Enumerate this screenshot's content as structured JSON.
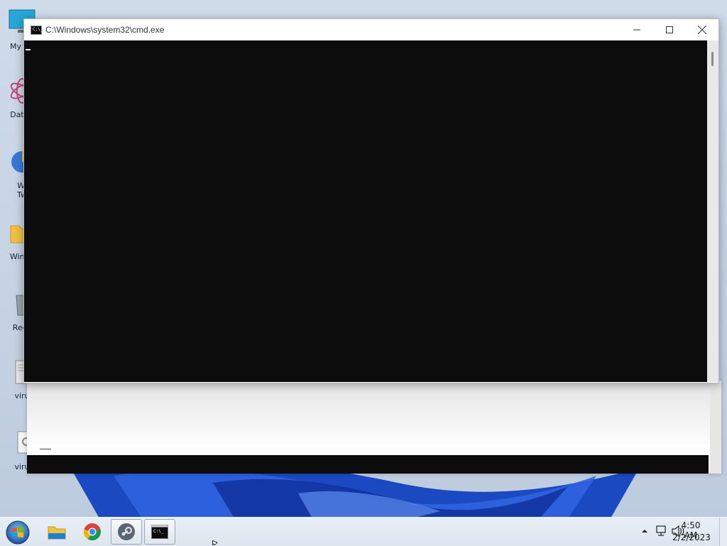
{
  "desktop": {
    "icons": [
      {
        "label": "My Co",
        "icon": "computer-icon"
      },
      {
        "label": "DataV",
        "icon": "datav-icon"
      },
      {
        "label": "Wi\nTw",
        "icon": "winaero-tweaker-icon"
      },
      {
        "label": "Windo",
        "icon": "folder-icon"
      },
      {
        "label": "Recy",
        "icon": "recycle-bin-icon"
      },
      {
        "label": "viru",
        "icon": "file-icon"
      },
      {
        "label": "viru",
        "icon": "settings-file-icon"
      }
    ]
  },
  "window": {
    "title": "C:\\Windows\\system32\\cmd.exe",
    "icon": "cmd-icon",
    "console_text": "",
    "buttons": {
      "minimize": "minimize-icon",
      "maximize": "maximize-icon",
      "close": "close-icon"
    }
  },
  "taskbar": {
    "start": "windows-start-icon",
    "items": [
      {
        "name": "file-explorer",
        "icon": "folder-icon",
        "active": false
      },
      {
        "name": "chrome",
        "icon": "chrome-icon",
        "active": false
      },
      {
        "name": "steam",
        "icon": "steam-icon",
        "active": true
      },
      {
        "name": "cmd",
        "icon": "cmd-icon",
        "active": true
      }
    ],
    "tray": {
      "clock_time": "4:50 AM",
      "clock_date": "2/2/2023",
      "icons": [
        "show-hidden-icons-icon",
        "network-icon",
        "volume-icon"
      ]
    }
  },
  "colors": {
    "console_bg": "#0c0c0c",
    "desktop_bg": "#c9d6e6",
    "wallpaper_blue": "#1f4fc4",
    "taskbar_bg": "#e3eaf2"
  }
}
